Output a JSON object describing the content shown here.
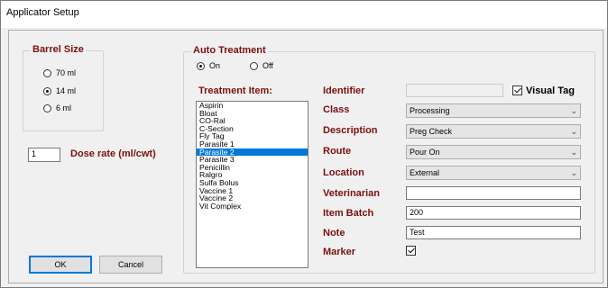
{
  "window": {
    "title": "Applicator Setup"
  },
  "barrel_size": {
    "title": "Barrel Size",
    "options": [
      {
        "label": "70 ml",
        "checked": false
      },
      {
        "label": "14 ml",
        "checked": true
      },
      {
        "label": "6 ml",
        "checked": false
      }
    ]
  },
  "dose": {
    "value": "1",
    "label": "Dose rate (ml/cwt)"
  },
  "auto_treatment": {
    "title": "Auto Treatment",
    "on_label": "On",
    "off_label": "Off",
    "selected": "On",
    "treatment_label": "Treatment Item:",
    "items": [
      "Aspirin",
      "Bloat",
      "CO-Ral",
      "C-Section",
      "Fly Tag",
      "Parasite 1",
      "Parasite 2",
      "Parasite 3",
      "Penicillin",
      "Ralgro",
      "Sulfa Bolus",
      "Vaccine 1",
      "Vaccine 2",
      "Vit Complex"
    ],
    "selected_item": "Parasite 2"
  },
  "form": {
    "identifier_label": "Identifier",
    "identifier_value": "",
    "visual_tag_label": "Visual Tag",
    "visual_tag_checked": true,
    "class_label": "Class",
    "class_value": "Processing",
    "description_label": "Description",
    "description_value": "Preg Check",
    "route_label": "Route",
    "route_value": "Pour On",
    "location_label": "Location",
    "location_value": "External",
    "veterinarian_label": "Veterinarian",
    "veterinarian_value": "",
    "item_batch_label": "Item Batch",
    "item_batch_value": "200",
    "note_label": "Note",
    "note_value": "Test",
    "marker_label": "Marker",
    "marker_checked": true
  },
  "buttons": {
    "ok": "OK",
    "cancel": "Cancel"
  }
}
